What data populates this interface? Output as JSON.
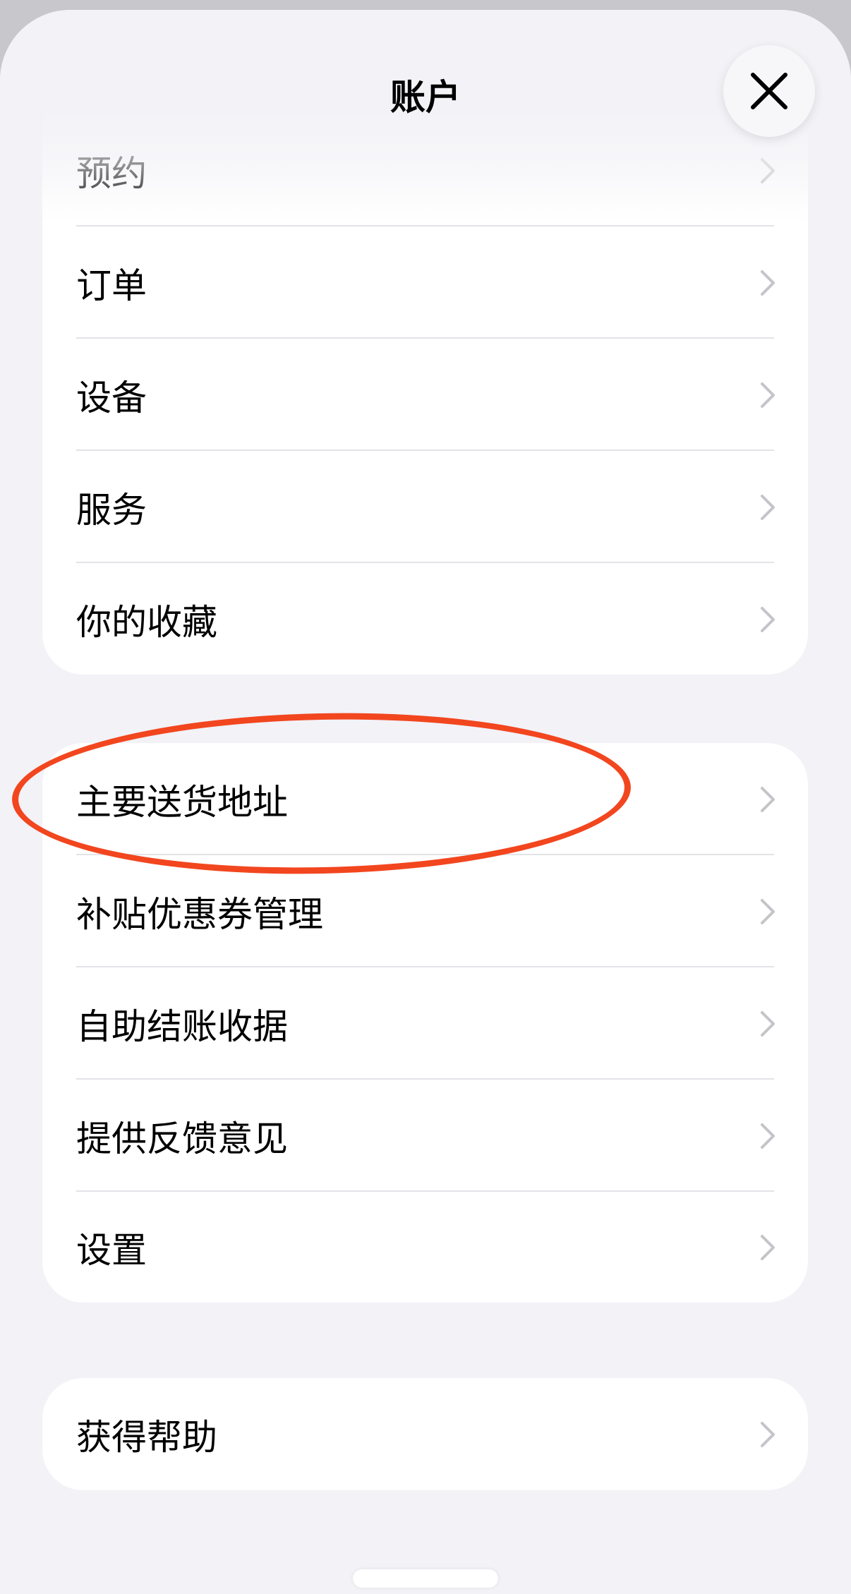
{
  "header": {
    "title": "账户",
    "close_icon": "close-icon"
  },
  "group1": {
    "items": [
      {
        "label": "预约"
      },
      {
        "label": "订单"
      },
      {
        "label": "设备"
      },
      {
        "label": "服务"
      },
      {
        "label": "你的收藏"
      }
    ]
  },
  "group2": {
    "items": [
      {
        "label": "主要送货地址"
      },
      {
        "label": "补贴优惠券管理"
      },
      {
        "label": "自助结账收据"
      },
      {
        "label": "提供反馈意见"
      },
      {
        "label": "设置"
      }
    ]
  },
  "group3": {
    "items": [
      {
        "label": "获得帮助"
      }
    ]
  },
  "colors": {
    "background": "#f2f2f7",
    "card": "#ffffff",
    "chevron": "#c4c4c9",
    "annotation": "#f2461f"
  }
}
